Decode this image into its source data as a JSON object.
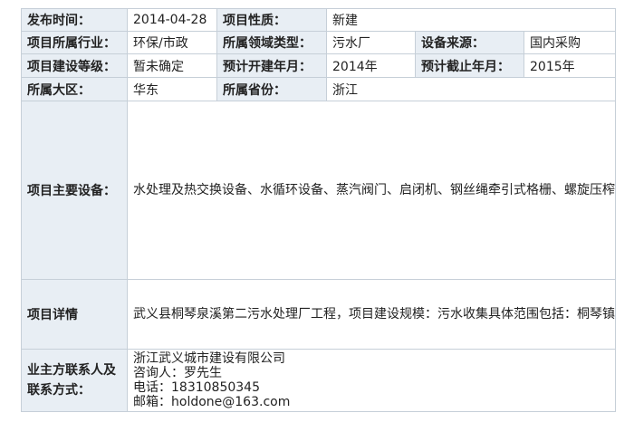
{
  "rows": {
    "publish_time": {
      "label": "发布时间：",
      "value": "2014-04-28"
    },
    "project_nature": {
      "label": "项目性质：",
      "value": "新建"
    },
    "industry": {
      "label": "项目所属行业：",
      "value": "环保/市政"
    },
    "domain_type": {
      "label": "所属领域类型：",
      "value": "污水厂"
    },
    "equipment_source": {
      "label": "设备来源：",
      "value": "国内采购"
    },
    "build_level": {
      "label": "项目建设等级：",
      "value": "暂未确定"
    },
    "start_year": {
      "label": "预计开建年月：",
      "value": "2014年"
    },
    "end_year": {
      "label": "预计截止年月：",
      "value": "2015年"
    },
    "region": {
      "label": "所属大区：",
      "value": "华东"
    },
    "province": {
      "label": "所属省份：",
      "value": "浙江"
    },
    "main_equipment": {
      "label": "项目主要设备：",
      "value": "水处理及热交换设备、水循环设备、蒸汽阀门、启闭机、钢丝绳牵引式格栅、螺旋压榨机、闸门、粗细格栅、除砂系统、潜水搅拌器、鼓风机、微孔曝气管、刮泥机、紫外消毒系统、带式污泥浓缩脱水一体机、各类检测仪器、泵、空气压缩机、罗茨鼓风机、离心鼓风机、表面曝气机、自动取水样机、格栅清污机、刮砂机、刮泥机、刮泥吸泥机、污泥浓缩刮泥机、消化池污泥搅拌设备、沼气锅炉、热交换器、药液搅拌机、污泥脱水机、交直流电动机、变速电机、启动开关设备、离心机、旋转式滚筒筛分机、超声波液位传感器、、螺旋给料机、气氛紧缩机等"
    },
    "details": {
      "label": "项目详情",
      "value": "武义县桐琴泉溪第二污水处理厂工程，项目建设规模：污水收集具体范围包括：桐琴镇工业区、沿线村庄与泉溪镇工业区、沿线村庄，服务范围约45km2，工程设计总规模为20000m3/d。"
    },
    "contact": {
      "label": "业主方联系人及联系方式：",
      "company": "浙江武义城市建设有限公司",
      "person": "咨询人：罗先生",
      "phone": "电话：18310850345",
      "email": "邮箱：holdone@163.com"
    }
  }
}
